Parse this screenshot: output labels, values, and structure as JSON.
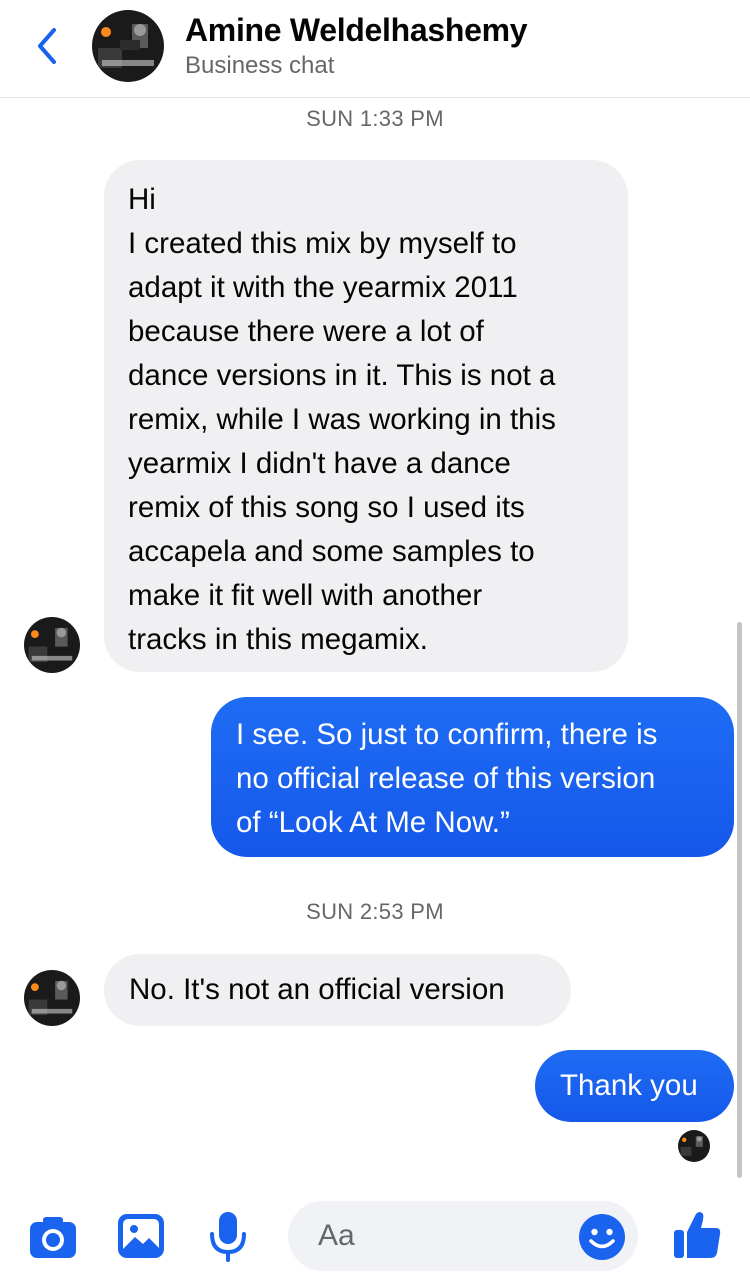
{
  "header": {
    "name": "Amine Weldelhashemy",
    "subtitle": "Business chat",
    "back_icon": "chevron-left-icon"
  },
  "colors": {
    "accent": "#1a63ee",
    "incoming_bubble": "#f0f0f2",
    "outgoing_bubble": "#1a63ee",
    "secondary_text": "#65676b"
  },
  "conversation": {
    "timestamp_1": "SUN 1:33 PM",
    "message_1": {
      "sender": "contact",
      "lines": [
        "Hi",
        "I created this mix by myself to",
        "adapt it with the yearmix 2011",
        "because there were a lot of",
        "dance versions in it. This is not a",
        "remix, while I was working in this",
        "yearmix I didn't have a dance",
        "remix of this song so I used its",
        "accapela and some samples to",
        "make it fit well with another",
        "tracks in this megamix."
      ]
    },
    "message_2": {
      "sender": "me",
      "lines": [
        "I see. So just to confirm, there is",
        "no official release of this version",
        "of “Look At Me Now.”"
      ]
    },
    "timestamp_2": "SUN 2:53 PM",
    "message_3": {
      "sender": "contact",
      "lines": [
        "No. It's not an official version"
      ]
    },
    "message_4": {
      "sender": "me",
      "lines": [
        "Thank you"
      ]
    }
  },
  "composer": {
    "placeholder": "Aa",
    "icons": [
      "camera-icon",
      "gallery-icon",
      "microphone-icon",
      "emoji-icon",
      "thumbs-up-icon"
    ]
  }
}
